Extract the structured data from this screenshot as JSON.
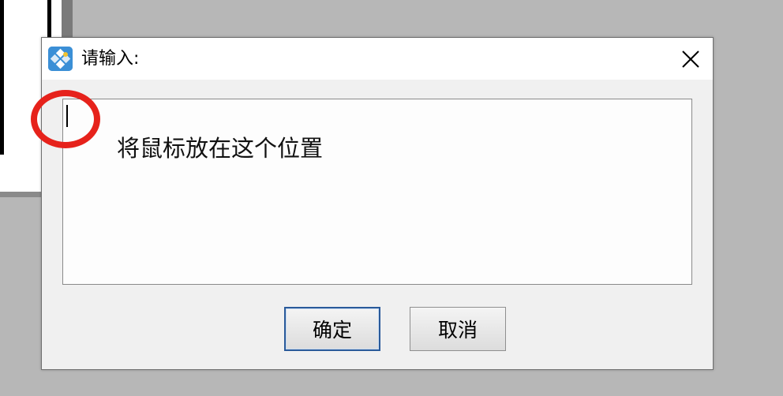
{
  "dialog": {
    "title": "请输入:",
    "app_icon": "app-icon",
    "close_icon": "close-icon",
    "content_text": "将鼠标放在这个位置",
    "buttons": {
      "ok_label": "确定",
      "cancel_label": "取消"
    }
  },
  "colors": {
    "annotation_circle": "#e6221b",
    "default_button_border": "#2a5a9a"
  }
}
